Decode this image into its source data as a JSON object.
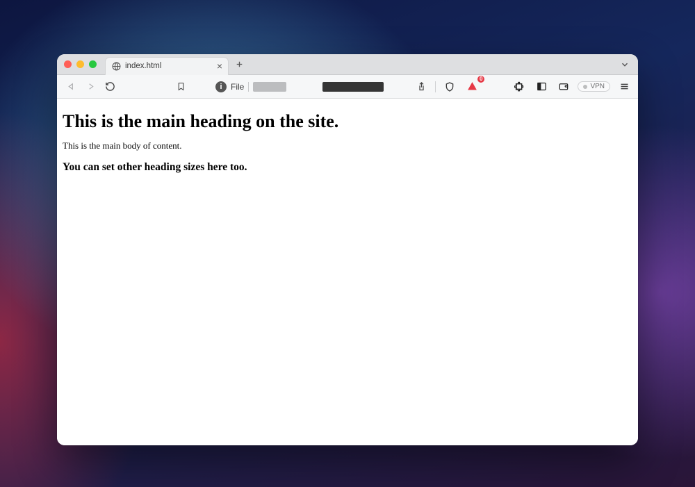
{
  "tab": {
    "title": "index.html",
    "favicon": "globe-icon"
  },
  "toolbar": {
    "url_scheme_label": "File",
    "vpn_label": "VPN",
    "brave_badge_count": "0"
  },
  "page": {
    "h1": "This is the main heading on the site.",
    "body_text": "This is the main body of content.",
    "h3": "You can set other heading sizes here too."
  }
}
